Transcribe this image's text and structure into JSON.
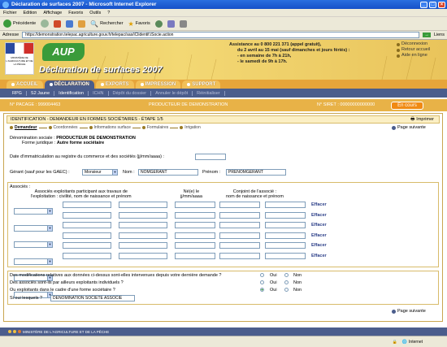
{
  "window": {
    "title": "Déclaration de surfaces 2007 - Microsoft Internet Explorer"
  },
  "menu": [
    "Fichier",
    "Edition",
    "Affichage",
    "Favoris",
    "Outils",
    "?"
  ],
  "toolbar": {
    "back": "Précédente",
    "search": "Rechercher",
    "favorites": "Favoris"
  },
  "address": {
    "label": "Adresse",
    "url": "https://demonstration.telepac.agriculture.gouv.fr/telepac/sas/iClidentif.iSocie.action",
    "links": "Liens"
  },
  "banner": {
    "ministry": "MINISTÈRE DE L'AGRICULTURE ET DE LA PÊCHE",
    "app": "AUP",
    "title": "Déclaration de surfaces 2007",
    "assist_lines": [
      "Assistance au 0 800 221 371 (appel gratuit),",
      "du 2 avril au 15 mai (sauf dimanches et jours fériés) :",
      "- en semaine de 7h à 21h,",
      "- le samedi de 9h à 17h."
    ],
    "links": [
      "Déconnexion",
      "Retour accueil",
      "Aide en ligne"
    ]
  },
  "tabs": [
    "ACCUEIL",
    "DÉCLARATION",
    "EXPORTS",
    "IMPRESSION",
    "SUPPORT"
  ],
  "subnav": [
    "RPG",
    "S2 Jaune",
    "Identification",
    "ICHN",
    "Dépôt du dossier",
    "Annuler le dépôt",
    "Réinitialiser"
  ],
  "infobar": {
    "pacage": "N° PACAGE : 999004463",
    "producer": "PRODUCTEUR DE DEMONSTRATION",
    "siret": "N° SIRET : 00000000000000",
    "status": "En cours"
  },
  "section": {
    "title": "IDENTIFICATION - DEMANDEUR EN FORMES SOCIÉTAIRES - ÉTAPE 1/5",
    "print": "Imprimer"
  },
  "steps": [
    "Demandeur",
    "Coordonnées",
    "Informations surface",
    "Formulaires",
    "Irrigation"
  ],
  "next_page": "Page suivante",
  "form": {
    "denomination_label": "Dénomination sociale :",
    "denomination_value": "PRODUCTEUR DE DEMONSTRATION",
    "forme_label": "Forme juridique :",
    "forme_value": "Autre forme sociétaire",
    "date_label": "Date d'immatriculation au registre du commerce et des sociétés (jj/mm/aaaa) :",
    "gerant_label": "Gérant (sauf pour les GAEC) :",
    "civilite": "Monsieur",
    "nom_label": "Nom :",
    "nom_value": "NOMGERANT",
    "prenom_label": "Prénom :",
    "prenom_value": "PRENOMGERANT"
  },
  "associes": {
    "label": "Associés :",
    "col1": [
      "Associés exploitants participant aux travaux de",
      "l'exploitation : civilité, nom de naissance et prénom"
    ],
    "col2": [
      "Né(e) le",
      "jj/mm/aaaa"
    ],
    "col3": [
      "Conjoint de l'associé :",
      "nom de naissance et prénom"
    ],
    "delete": "Effacer"
  },
  "questions": [
    {
      "q": "Des modifications relatives aux données ci-dessus sont-elles intervenues depuis votre dernière demande ?",
      "a": "none"
    },
    {
      "q": "Des associés sont-ils par ailleurs exploitants individuels ?",
      "a": "none"
    },
    {
      "q": "Ou exploitants dans le cadre d'une forme sociétaire ?",
      "a": "oui"
    }
  ],
  "oui": "Oui",
  "non": "Non",
  "si_oui_label": "Si oui lesquels ?",
  "si_oui_value": "DENOMINATION SOCIETE ASSOCIE",
  "footer": "MINISTÈRE DE L'AGRICULTURE ET DE LA PÊCHE",
  "status": {
    "zone": "Internet"
  }
}
